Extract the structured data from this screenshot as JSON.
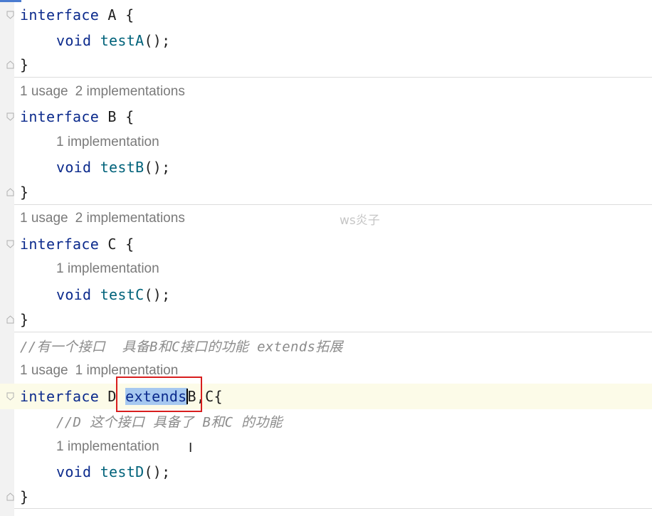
{
  "interfaces": [
    {
      "keyword": "interface",
      "name": "A",
      "brace": "{",
      "method_type": "void",
      "method_name": "testA",
      "method_suffix": "();",
      "close": "}"
    },
    {
      "keyword": "interface",
      "name": "B",
      "brace": "{",
      "usage_hint": "1 usage",
      "impl_hint": "2 implementations",
      "method_hint": "1 implementation",
      "method_type": "void",
      "method_name": "testB",
      "method_suffix": "();",
      "close": "}"
    },
    {
      "keyword": "interface",
      "name": "C",
      "brace": "{",
      "usage_hint": "1 usage",
      "impl_hint": "2 implementations",
      "method_hint": "1 implementation",
      "method_type": "void",
      "method_name": "testC",
      "method_suffix": "();",
      "close": "}"
    }
  ],
  "comment_line": "//有一个接口  具备B和C接口的功能 extends拓展",
  "interface_d": {
    "usage_hint": "1 usage",
    "impl_hint": "1 implementation",
    "keyword": "interface",
    "name": "D",
    "extends": "extends",
    "rest": "B,C{",
    "inner_comment": "//D 这个接口 具备了 B和C 的功能",
    "method_hint": "1 implementation",
    "method_type": "void",
    "method_name": "testD",
    "method_suffix": "();",
    "close": "}"
  },
  "watermark": "ws炎子",
  "cursor_glyph": "I",
  "colors": {
    "keyword": "#0b2a8c",
    "method": "#00627a",
    "comment": "#8c8c8c",
    "hint": "#7a7a7a",
    "selection": "#a6c8f0",
    "highlight_box": "#d81e1e",
    "current_line": "#fcfbe8"
  }
}
